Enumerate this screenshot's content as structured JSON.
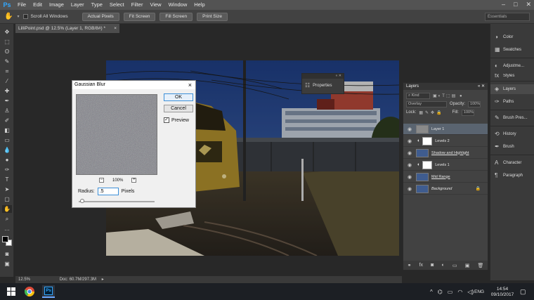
{
  "app": {
    "logo": "Ps",
    "menu": [
      "File",
      "Edit",
      "Image",
      "Layer",
      "Type",
      "Select",
      "Filter",
      "View",
      "Window",
      "Help"
    ],
    "window_controls": [
      "–",
      "□",
      "✕"
    ]
  },
  "options_bar": {
    "scroll_all_windows": "Scroll All Windows",
    "actual_pixels": "Actual Pixels",
    "fit_screen": "Fit Screen",
    "fill_screen": "Fill Screen",
    "print_size": "Print Size",
    "workspace": "Essentials"
  },
  "document": {
    "tab_title": "LilliPoint.psd @ 12.5% (Layer 1, RGB/8#) *",
    "zoom": "12.5%",
    "doc_info": "Doc: 60.7M/297.3M"
  },
  "dock": {
    "items": [
      {
        "icon": "color-icon",
        "label": "Color"
      },
      {
        "icon": "swatches-icon",
        "label": "Swatches"
      },
      {
        "icon": "adjustments-icon",
        "label": "Adjustme..."
      },
      {
        "icon": "styles-icon",
        "label": "Styles"
      },
      {
        "icon": "layers-icon",
        "label": "Layers"
      },
      {
        "icon": "paths-icon",
        "label": "Paths"
      },
      {
        "icon": "brush-presets-icon",
        "label": "Brush Pres..."
      },
      {
        "icon": "history-icon",
        "label": "History"
      },
      {
        "icon": "brush-icon",
        "label": "Brush"
      },
      {
        "icon": "character-icon",
        "label": "Character"
      },
      {
        "icon": "paragraph-icon",
        "label": "Paragraph"
      }
    ]
  },
  "properties": {
    "label": "Properties"
  },
  "layers_panel": {
    "title": "Layers",
    "filter": "Kind",
    "blend_mode": "Overlay",
    "opacity_label": "Opacity:",
    "opacity_value": "100%",
    "lock_label": "Lock:",
    "fill_label": "Fill:",
    "fill_value": "100%",
    "layers": [
      {
        "name": "Layer 1",
        "selected": true,
        "mask": false
      },
      {
        "name": "Levels 2",
        "selected": false,
        "mask": true
      },
      {
        "name": "Shadow and Highlight",
        "selected": false,
        "mask": false
      },
      {
        "name": "Levels 1",
        "selected": false,
        "mask": true
      },
      {
        "name": "Mid Range",
        "selected": false,
        "mask": false
      },
      {
        "name": "Background",
        "selected": false,
        "mask": false
      }
    ]
  },
  "gaussian_blur": {
    "title": "Gaussian Blur",
    "ok": "OK",
    "cancel": "Cancel",
    "preview_label": "Preview",
    "preview_checked": true,
    "zoom": "100%",
    "radius_label": "Radius:",
    "radius_value": ".5",
    "radius_unit": "Pixels",
    "slider_fraction": 0.02
  },
  "taskbar": {
    "language": "ENG",
    "time": "14:54",
    "date": "09/10/2017"
  }
}
